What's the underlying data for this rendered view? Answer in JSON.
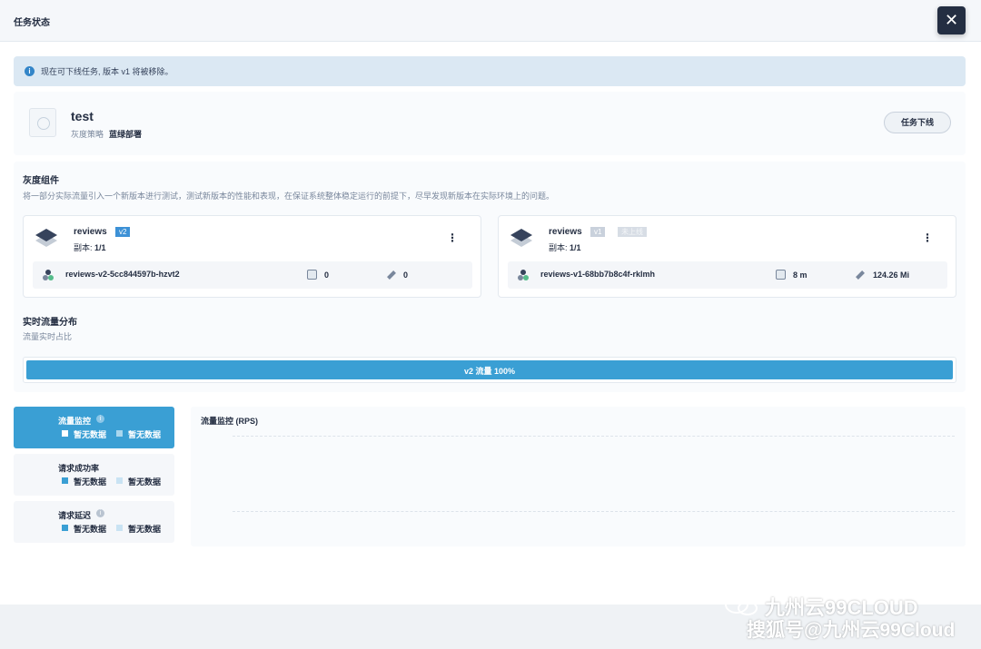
{
  "header": {
    "title": "任务状态",
    "close_icon": "close-icon"
  },
  "alert": {
    "icon": "info-icon",
    "message": "现在可下线任务, 版本 v1 将被移除。"
  },
  "app": {
    "name": "test",
    "strategy_label": "灰度策略",
    "strategy_value": "蓝绿部署",
    "offline_button": "任务下线"
  },
  "components": {
    "title": "灰度组件",
    "description": "将一部分实际流量引入一个新版本进行测试，测试新版本的性能和表现，在保证系统整体稳定运行的前提下，尽早发现新版本在实际环境上的问题。",
    "cards": [
      {
        "name": "reviews",
        "version_tag": "v2",
        "replica_label": "副本: ",
        "replica_value": "1/1",
        "pod_name": "reviews-v2-5cc844597b-hzvt2",
        "cpu": "0",
        "memory": "0"
      },
      {
        "name": "reviews",
        "version_tag": "v1",
        "status_tag": "未上线",
        "replica_label": "副本: ",
        "replica_value": "1/1",
        "pod_name": "reviews-v1-68bb7b8c4f-rklmh",
        "cpu": "8 m",
        "memory": "124.26 Mi"
      }
    ]
  },
  "traffic": {
    "title": "实时流量分布",
    "subtitle": "流量实时占比",
    "bar_label": "v2 流量 100%",
    "v2_fraction": 1.0
  },
  "monitoring": {
    "tabs": [
      {
        "title": "流量监控",
        "has_info": true,
        "legend": [
          "暂无数据",
          "暂无数据"
        ],
        "active": true
      },
      {
        "title": "请求成功率",
        "has_info": false,
        "legend": [
          "暂无数据",
          "暂无数据"
        ],
        "active": false
      },
      {
        "title": "请求延迟",
        "has_info": true,
        "legend": [
          "暂无数据",
          "暂无数据"
        ],
        "active": false
      }
    ],
    "chart_title": "流量监控 (RPS)"
  },
  "colors": {
    "accent": "#3a9fd4",
    "dark": "#242e42",
    "tag_blue": "#3d91d6"
  },
  "watermark": {
    "line1": "九州云99CLOUD",
    "line2": "搜狐号@九州云99Cloud"
  }
}
